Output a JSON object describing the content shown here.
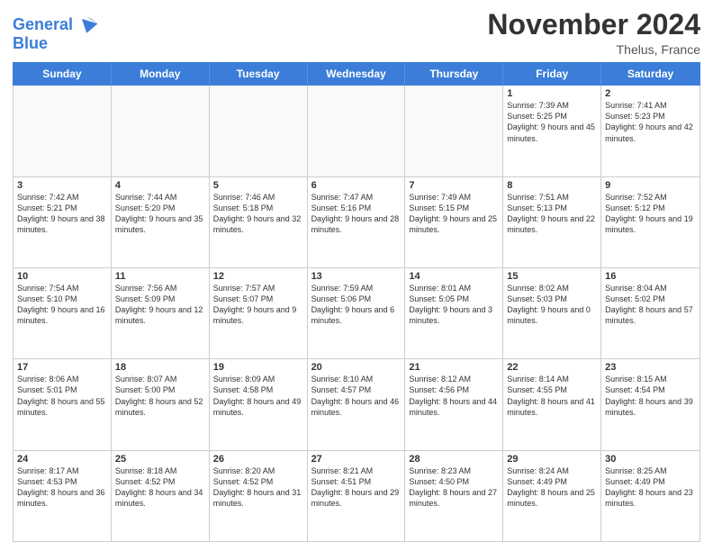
{
  "logo": {
    "line1": "General",
    "line2": "Blue"
  },
  "title": "November 2024",
  "location": "Thelus, France",
  "weekdays": [
    "Sunday",
    "Monday",
    "Tuesday",
    "Wednesday",
    "Thursday",
    "Friday",
    "Saturday"
  ],
  "rows": [
    [
      {
        "day": "",
        "info": "",
        "empty": true
      },
      {
        "day": "",
        "info": "",
        "empty": true
      },
      {
        "day": "",
        "info": "",
        "empty": true
      },
      {
        "day": "",
        "info": "",
        "empty": true
      },
      {
        "day": "",
        "info": "",
        "empty": true
      },
      {
        "day": "1",
        "info": "Sunrise: 7:39 AM\nSunset: 5:25 PM\nDaylight: 9 hours and 45 minutes.",
        "empty": false
      },
      {
        "day": "2",
        "info": "Sunrise: 7:41 AM\nSunset: 5:23 PM\nDaylight: 9 hours and 42 minutes.",
        "empty": false
      }
    ],
    [
      {
        "day": "3",
        "info": "Sunrise: 7:42 AM\nSunset: 5:21 PM\nDaylight: 9 hours and 38 minutes.",
        "empty": false
      },
      {
        "day": "4",
        "info": "Sunrise: 7:44 AM\nSunset: 5:20 PM\nDaylight: 9 hours and 35 minutes.",
        "empty": false
      },
      {
        "day": "5",
        "info": "Sunrise: 7:46 AM\nSunset: 5:18 PM\nDaylight: 9 hours and 32 minutes.",
        "empty": false
      },
      {
        "day": "6",
        "info": "Sunrise: 7:47 AM\nSunset: 5:16 PM\nDaylight: 9 hours and 28 minutes.",
        "empty": false
      },
      {
        "day": "7",
        "info": "Sunrise: 7:49 AM\nSunset: 5:15 PM\nDaylight: 9 hours and 25 minutes.",
        "empty": false
      },
      {
        "day": "8",
        "info": "Sunrise: 7:51 AM\nSunset: 5:13 PM\nDaylight: 9 hours and 22 minutes.",
        "empty": false
      },
      {
        "day": "9",
        "info": "Sunrise: 7:52 AM\nSunset: 5:12 PM\nDaylight: 9 hours and 19 minutes.",
        "empty": false
      }
    ],
    [
      {
        "day": "10",
        "info": "Sunrise: 7:54 AM\nSunset: 5:10 PM\nDaylight: 9 hours and 16 minutes.",
        "empty": false
      },
      {
        "day": "11",
        "info": "Sunrise: 7:56 AM\nSunset: 5:09 PM\nDaylight: 9 hours and 12 minutes.",
        "empty": false
      },
      {
        "day": "12",
        "info": "Sunrise: 7:57 AM\nSunset: 5:07 PM\nDaylight: 9 hours and 9 minutes.",
        "empty": false
      },
      {
        "day": "13",
        "info": "Sunrise: 7:59 AM\nSunset: 5:06 PM\nDaylight: 9 hours and 6 minutes.",
        "empty": false
      },
      {
        "day": "14",
        "info": "Sunrise: 8:01 AM\nSunset: 5:05 PM\nDaylight: 9 hours and 3 minutes.",
        "empty": false
      },
      {
        "day": "15",
        "info": "Sunrise: 8:02 AM\nSunset: 5:03 PM\nDaylight: 9 hours and 0 minutes.",
        "empty": false
      },
      {
        "day": "16",
        "info": "Sunrise: 8:04 AM\nSunset: 5:02 PM\nDaylight: 8 hours and 57 minutes.",
        "empty": false
      }
    ],
    [
      {
        "day": "17",
        "info": "Sunrise: 8:06 AM\nSunset: 5:01 PM\nDaylight: 8 hours and 55 minutes.",
        "empty": false
      },
      {
        "day": "18",
        "info": "Sunrise: 8:07 AM\nSunset: 5:00 PM\nDaylight: 8 hours and 52 minutes.",
        "empty": false
      },
      {
        "day": "19",
        "info": "Sunrise: 8:09 AM\nSunset: 4:58 PM\nDaylight: 8 hours and 49 minutes.",
        "empty": false
      },
      {
        "day": "20",
        "info": "Sunrise: 8:10 AM\nSunset: 4:57 PM\nDaylight: 8 hours and 46 minutes.",
        "empty": false
      },
      {
        "day": "21",
        "info": "Sunrise: 8:12 AM\nSunset: 4:56 PM\nDaylight: 8 hours and 44 minutes.",
        "empty": false
      },
      {
        "day": "22",
        "info": "Sunrise: 8:14 AM\nSunset: 4:55 PM\nDaylight: 8 hours and 41 minutes.",
        "empty": false
      },
      {
        "day": "23",
        "info": "Sunrise: 8:15 AM\nSunset: 4:54 PM\nDaylight: 8 hours and 39 minutes.",
        "empty": false
      }
    ],
    [
      {
        "day": "24",
        "info": "Sunrise: 8:17 AM\nSunset: 4:53 PM\nDaylight: 8 hours and 36 minutes.",
        "empty": false
      },
      {
        "day": "25",
        "info": "Sunrise: 8:18 AM\nSunset: 4:52 PM\nDaylight: 8 hours and 34 minutes.",
        "empty": false
      },
      {
        "day": "26",
        "info": "Sunrise: 8:20 AM\nSunset: 4:52 PM\nDaylight: 8 hours and 31 minutes.",
        "empty": false
      },
      {
        "day": "27",
        "info": "Sunrise: 8:21 AM\nSunset: 4:51 PM\nDaylight: 8 hours and 29 minutes.",
        "empty": false
      },
      {
        "day": "28",
        "info": "Sunrise: 8:23 AM\nSunset: 4:50 PM\nDaylight: 8 hours and 27 minutes.",
        "empty": false
      },
      {
        "day": "29",
        "info": "Sunrise: 8:24 AM\nSunset: 4:49 PM\nDaylight: 8 hours and 25 minutes.",
        "empty": false
      },
      {
        "day": "30",
        "info": "Sunrise: 8:25 AM\nSunset: 4:49 PM\nDaylight: 8 hours and 23 minutes.",
        "empty": false
      }
    ]
  ]
}
